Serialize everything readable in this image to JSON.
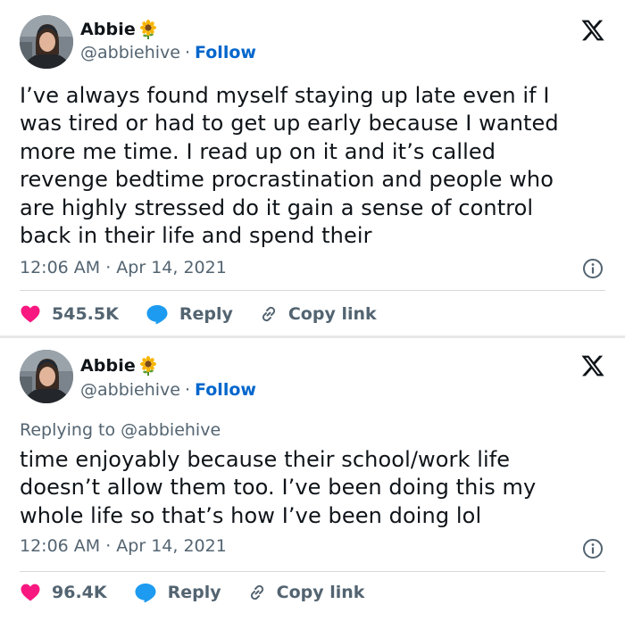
{
  "tweets": [
    {
      "author_name": "Abbie",
      "handle": "@abbiehive",
      "separator": "·",
      "follow_label": "Follow",
      "text": "I’ve always found myself staying up late even if I\nwas tired or had to get up early because I wanted\nmore me time. I read up on it and it’s called\nrevenge bedtime procrastination and people who\nare highly stressed do it gain a sense of control\nback in their life and spend their",
      "timestamp": "12:06 AM · Apr 14, 2021",
      "likes": "545.5K",
      "reply_label": "Reply",
      "copy_link_label": "Copy link"
    },
    {
      "author_name": "Abbie",
      "handle": "@abbiehive",
      "separator": "·",
      "follow_label": "Follow",
      "replying_to": "Replying to @abbiehive",
      "text": "time enjoyably because their school/work life\ndoesn’t allow them too. I’ve been doing this my\nwhole life so that’s how I’ve been doing lol",
      "timestamp": "12:06 AM · Apr 14, 2021",
      "likes": "96.4K",
      "reply_label": "Reply",
      "copy_link_label": "Copy link"
    }
  ],
  "icons": {
    "name_emoji": "sunflower-icon",
    "brand": "x-logo-icon",
    "info": "info-icon",
    "like": "heart-icon",
    "reply": "speech-bubble-icon",
    "copy": "link-icon"
  },
  "colors": {
    "heart": "#f91880",
    "reply_bubble": "#1d9bf0",
    "follow": "#0066cc",
    "muted": "#536471",
    "text": "#0f1419"
  }
}
